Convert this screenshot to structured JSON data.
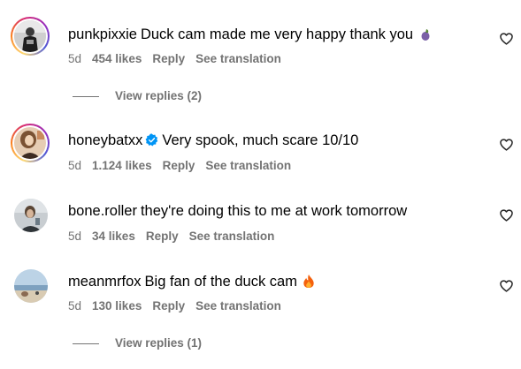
{
  "comments": [
    {
      "username": "punkpixxie",
      "text": "Duck cam made me very happy thank you",
      "emoji": "eggplant",
      "time": "5d",
      "likes": "454 likes",
      "reply": "Reply",
      "translate": "See translation",
      "view_replies": "View replies (2)",
      "verified": false
    },
    {
      "username": "honeybatxx",
      "text": "Very spook, much scare 10/10",
      "time": "5d",
      "likes": "1.124 likes",
      "reply": "Reply",
      "translate": "See translation",
      "verified": true
    },
    {
      "username": "bone.roller",
      "text": "they're doing this to me at work tomorrow",
      "time": "5d",
      "likes": "34 likes",
      "reply": "Reply",
      "translate": "See translation",
      "verified": false
    },
    {
      "username": "meanmrfox",
      "text": "Big fan of the duck cam",
      "emoji": "fire",
      "time": "5d",
      "likes": "130 likes",
      "reply": "Reply",
      "translate": "See translation",
      "view_replies": "View replies (1)",
      "verified": false
    }
  ],
  "colors": {
    "meta_text": "#737373",
    "verified_blue": "#0095f6"
  },
  "icons": {
    "like": "heart-outline-icon",
    "verified": "verified-badge-icon"
  }
}
